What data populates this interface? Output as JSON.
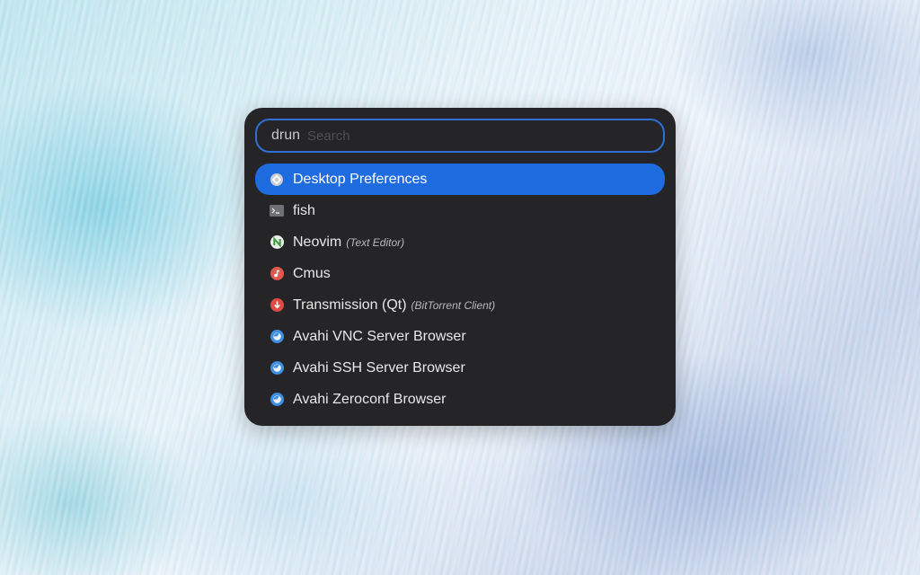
{
  "launcher": {
    "mode": "drun",
    "search": {
      "value": "",
      "placeholder": "Search"
    },
    "results": [
      {
        "name": "Desktop Preferences",
        "description": "",
        "icon": "gear-icon",
        "selected": true
      },
      {
        "name": "fish",
        "description": "",
        "icon": "terminal-icon",
        "selected": false
      },
      {
        "name": "Neovim",
        "description": "(Text Editor)",
        "icon": "neovim-icon",
        "selected": false
      },
      {
        "name": "Cmus",
        "description": "",
        "icon": "music-note-icon",
        "selected": false
      },
      {
        "name": "Transmission (Qt)",
        "description": "(BitTorrent Client)",
        "icon": "download-arrow-icon",
        "selected": false
      },
      {
        "name": "Avahi VNC Server Browser",
        "description": "",
        "icon": "network-globe-icon",
        "selected": false
      },
      {
        "name": "Avahi SSH Server Browser",
        "description": "",
        "icon": "network-globe-icon",
        "selected": false
      },
      {
        "name": "Avahi Zeroconf Browser",
        "description": "",
        "icon": "network-globe-icon",
        "selected": false
      }
    ]
  },
  "colors": {
    "accent": "#1f6be0",
    "search_border": "#2f6fd6",
    "panel_background": "#252527"
  }
}
